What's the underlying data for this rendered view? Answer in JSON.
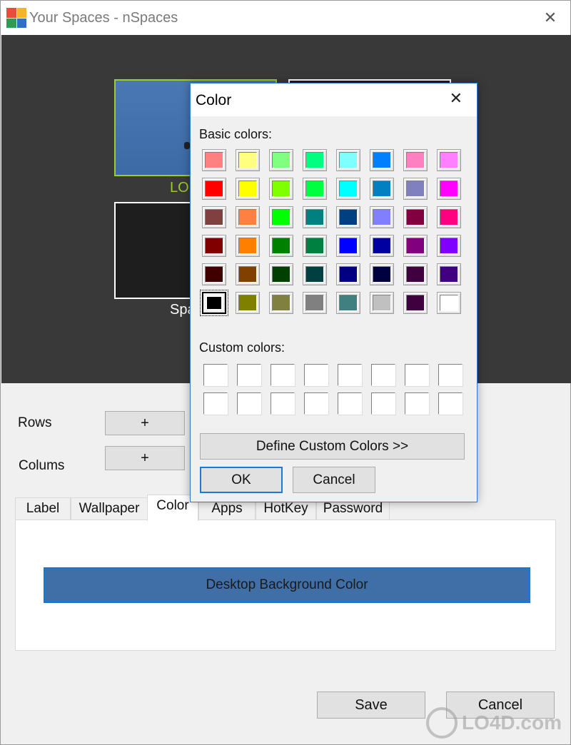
{
  "window": {
    "title": "Your Spaces - nSpaces",
    "close_glyph": "✕",
    "icon": "nspaces-app-icon",
    "icon_colors": [
      "#e84c3d",
      "#f3b32a",
      "#2e9c4f",
      "#2f6fc8"
    ]
  },
  "preview": {
    "space_1_label": "LO",
    "space_3_label": "Spa",
    "active_color": "#9ccd2e"
  },
  "grid_controls": {
    "rows_label": "Rows",
    "columns_label": "Colums",
    "add_row_label": "+",
    "add_column_label": "+"
  },
  "tabs": [
    {
      "label": "Label"
    },
    {
      "label": "Wallpaper"
    },
    {
      "label": "Color",
      "active": true
    },
    {
      "label": "Apps"
    },
    {
      "label": "HotKey"
    },
    {
      "label": "Password"
    }
  ],
  "color_tab": {
    "desktop_bg_button": "Desktop Background Color",
    "button_color": "#3f6fa6"
  },
  "footer": {
    "save_label": "Save",
    "cancel_label": "Cancel"
  },
  "watermark": {
    "text": "LO4D.com"
  },
  "color_dialog": {
    "title": "Color",
    "close_glyph": "✕",
    "basic_colors_label": "Basic colors:",
    "custom_colors_label": "Custom colors:",
    "define_custom_label": "Define Custom Colors >>",
    "ok_label": "OK",
    "cancel_label": "Cancel",
    "selected_index": 40,
    "basic_colors": [
      "#ff8080",
      "#ffff80",
      "#80ff80",
      "#00ff80",
      "#80ffff",
      "#0080ff",
      "#ff80c0",
      "#ff80ff",
      "#ff0000",
      "#ffff00",
      "#80ff00",
      "#00ff40",
      "#00ffff",
      "#0080c0",
      "#8080c0",
      "#ff00ff",
      "#804040",
      "#ff8040",
      "#00ff00",
      "#008080",
      "#004080",
      "#8080ff",
      "#800040",
      "#ff0080",
      "#800000",
      "#ff8000",
      "#008000",
      "#008040",
      "#0000ff",
      "#0000a0",
      "#800080",
      "#8000ff",
      "#400000",
      "#804000",
      "#004000",
      "#004040",
      "#000080",
      "#000040",
      "#400040",
      "#400080",
      "#000000",
      "#808000",
      "#808040",
      "#808080",
      "#408080",
      "#c0c0c0",
      "#400040",
      "#ffffff"
    ],
    "custom_colors": [
      "#ffffff",
      "#ffffff",
      "#ffffff",
      "#ffffff",
      "#ffffff",
      "#ffffff",
      "#ffffff",
      "#ffffff",
      "#ffffff",
      "#ffffff",
      "#ffffff",
      "#ffffff",
      "#ffffff",
      "#ffffff",
      "#ffffff",
      "#ffffff"
    ]
  }
}
